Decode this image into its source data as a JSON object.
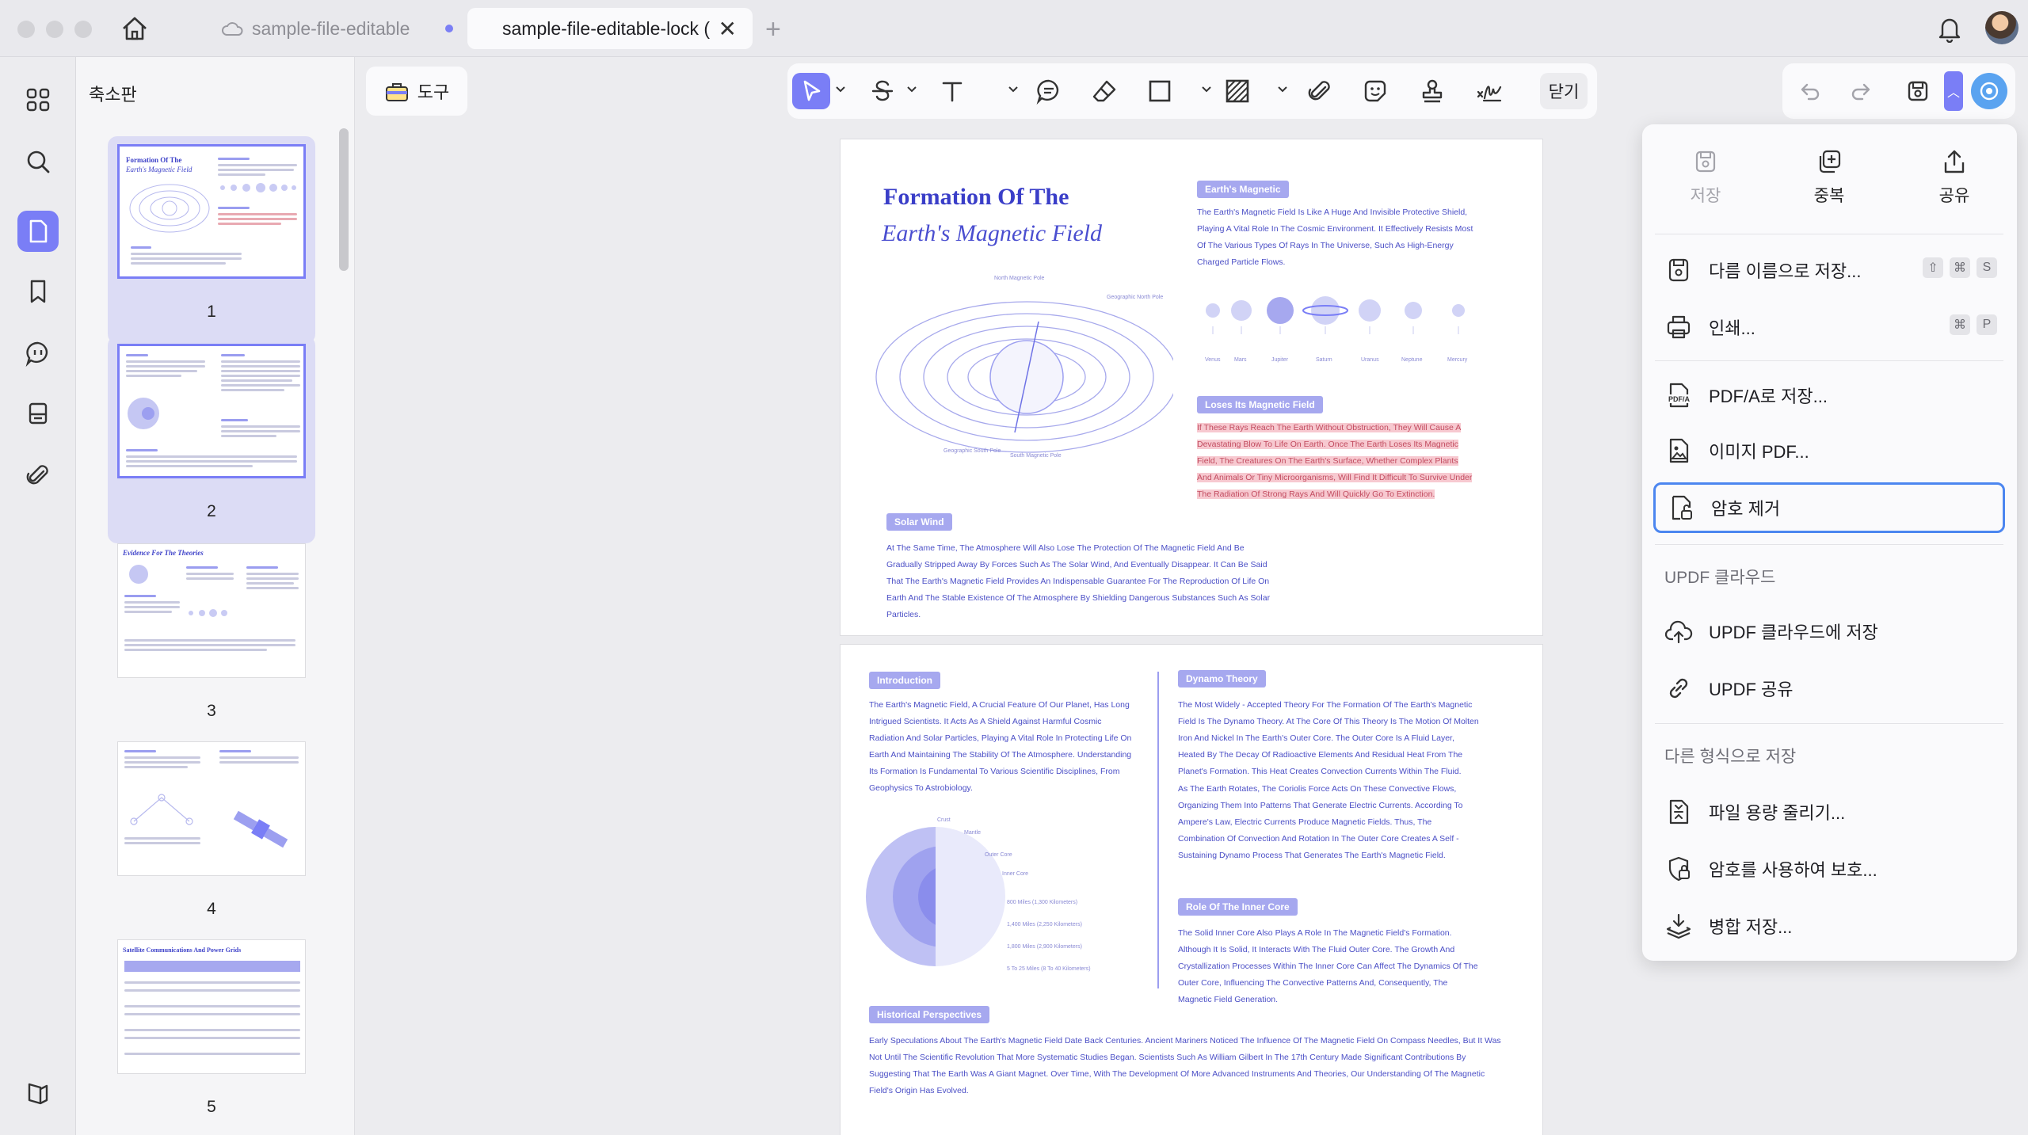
{
  "window": {
    "tabs": [
      {
        "label": "sample-file-editable",
        "active": false
      },
      {
        "label": "sample-file-editable-lock (",
        "active": true
      }
    ]
  },
  "thumbnail_panel": {
    "title": "축소판",
    "pages": [
      {
        "num": "1",
        "title": "Formation Of The",
        "subtitle": "Earth's Magnetic Field"
      },
      {
        "num": "2"
      },
      {
        "num": "3",
        "title": "Evidence For The Theories"
      },
      {
        "num": "4"
      },
      {
        "num": "5",
        "title": "Satellite Communications And Power Grids"
      }
    ]
  },
  "toolbar": {
    "tools_label": "도구",
    "close_label": "닫기"
  },
  "document": {
    "page1": {
      "title_line1": "Formation Of The",
      "title_line2": "Earth's Magnetic Field",
      "section1_heading": "Earth's Magnetic",
      "section1_text": "The Earth's Magnetic Field Is Like A Huge And Invisible Protective Shield, Playing A Vital Role In The Cosmic Environment. It Effectively Resists Most Of The Various Types Of Rays In The Universe, Such As High-Energy Charged Particle Flows.",
      "planets": [
        "Venus",
        "Mars",
        "Jupiter",
        "Saturn",
        "Uranus",
        "Neptune",
        "Mercury"
      ],
      "section2_heading": "Loses Its Magnetic Field",
      "section2_text": "If These Rays Reach The Earth Without Obstruction, They Will Cause A Devastating Blow To Life On Earth. Once The Earth Loses Its Magnetic Field, The Creatures On The Earth's Surface, Whether Complex Plants And Animals Or Tiny Microorganisms, Will Find It Difficult To Survive Under The Radiation Of Strong Rays And Will Quickly Go To Extinction.",
      "diagram_labels": {
        "north_magnetic_pole": "North Magnetic Pole",
        "geographic_north_pole": "Geographic North Pole",
        "geographic_south_pole": "Geographic South Pole",
        "south_magnetic_pole": "South Magnetic Pole"
      },
      "section3_heading": "Solar Wind",
      "section3_text": "At The Same Time, The Atmosphere Will Also Lose The Protection Of The Magnetic Field And Be Gradually Stripped Away By Forces Such As The Solar Wind, And Eventually Disappear. It Can Be Said That The Earth's Magnetic Field Provides An Indispensable Guarantee For The Reproduction Of Life On Earth And The Stable Existence Of The Atmosphere By Shielding Dangerous Substances Such As Solar Particles."
    },
    "page2": {
      "intro_heading": "Introduction",
      "intro_text": "The Earth's Magnetic Field, A Crucial Feature Of Our Planet, Has Long Intrigued Scientists. It Acts As A Shield Against Harmful Cosmic Radiation And Solar Particles, Playing A Vital Role In Protecting Life On Earth And Maintaining The Stability Of The Atmosphere. Understanding Its Formation Is Fundamental To Various Scientific Disciplines, From Geophysics To Astrobiology.",
      "layers": {
        "crust": "Crust",
        "mantle": "Mantle",
        "outer_core": "Outer Core",
        "inner_core": "Inner Core",
        "d1": "800 Miles (1,300 Kilometers)",
        "d2": "1,400 Miles (2,250 Kilometers)",
        "d3": "1,800 Miles (2,900 Kilometers)",
        "d4": "5 To 25 Miles (8 To 40 Kilometers)"
      },
      "dynamo_heading": "Dynamo Theory",
      "dynamo_text": "The Most Widely - Accepted Theory For The Formation Of The Earth's Magnetic Field Is The Dynamo Theory. At The Core Of This Theory Is The Motion Of Molten Iron And Nickel In The Earth's Outer Core. The Outer Core Is A Fluid Layer, Heated By The Decay Of Radioactive Elements And Residual Heat From The Planet's Formation. This Heat Creates Convection Currents Within The Fluid.",
      "dynamo_text2": "As The Earth Rotates, The Coriolis Force Acts On These Convective Flows, Organizing Them Into Patterns That Generate Electric Currents. According To Ampere's Law, Electric Currents Produce Magnetic Fields. Thus, The Combination Of Convection And Rotation In The Outer Core Creates A Self - Sustaining Dynamo Process That Generates The Earth's Magnetic Field.",
      "inner_heading": "Role Of The Inner Core",
      "inner_text": "The Solid Inner Core Also Plays A Role In The Magnetic Field's Formation. Although It Is Solid, It Interacts With The Fluid Outer Core. The Growth And Crystallization Processes Within The Inner Core Can Affect The Dynamics Of The Outer Core, Influencing The Convective Patterns And, Consequently, The Magnetic Field Generation.",
      "hist_heading": "Historical Perspectives",
      "hist_text": "Early Speculations About The Earth's Magnetic Field Date Back Centuries. Ancient Mariners Noticed The Influence Of The Magnetic Field On Compass Needles, But It Was Not Until The Scientific Revolution That More Systematic Studies Began. Scientists Such As William Gilbert In The 17th Century Made Significant Contributions By Suggesting That The Earth Was A Giant Magnet. Over Time, With The Development Of More Advanced Instruments And Theories, Our Understanding Of The Magnetic Field's Origin Has Evolved."
    }
  },
  "menu": {
    "quick_actions": [
      {
        "label": "저장",
        "icon": "save-icon",
        "enabled": false
      },
      {
        "label": "중복",
        "icon": "duplicate-icon",
        "enabled": true
      },
      {
        "label": "공유",
        "icon": "share-icon",
        "enabled": true
      }
    ],
    "save_as": {
      "label": "다름 이름으로 저장...",
      "shortcut": [
        "⇧",
        "⌘",
        "S"
      ]
    },
    "print": {
      "label": "인쇄...",
      "shortcut": [
        "⌘",
        "P"
      ]
    },
    "pdfa": {
      "label": "PDF/A로 저장..."
    },
    "image_pdf": {
      "label": "이미지 PDF..."
    },
    "remove_password": {
      "label": "암호 제거"
    },
    "cloud_section": "UPDF 클라우드",
    "cloud_save": {
      "label": "UPDF 클라우드에 저장"
    },
    "cloud_share": {
      "label": "UPDF 공유"
    },
    "other_section": "다른 형식으로 저장",
    "compress": {
      "label": "파일 용량 줄리기..."
    },
    "protect": {
      "label": "암호를 사용하여 보호..."
    },
    "flatten": {
      "label": "병합 저장..."
    }
  },
  "colors": {
    "accent": "#7a7ef6",
    "focus": "#4c86f0",
    "doc_text": "#4b4fc6"
  }
}
